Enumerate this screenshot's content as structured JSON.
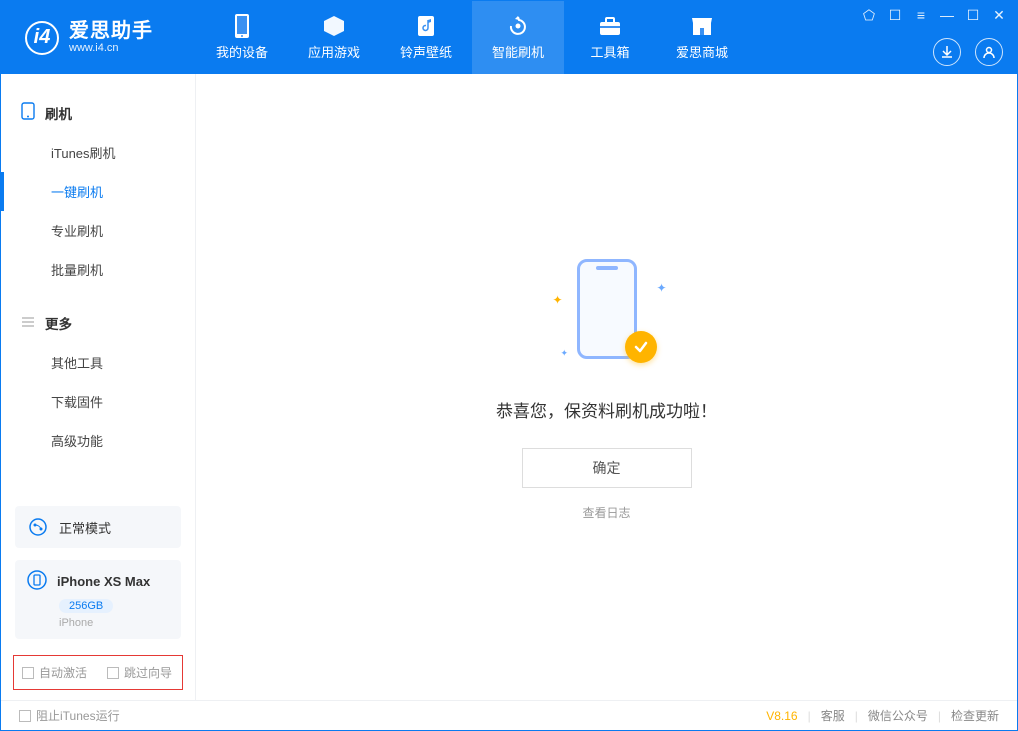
{
  "brand": {
    "logo_glyph": "i4",
    "title": "爱思助手",
    "subtitle": "www.i4.cn"
  },
  "tabs": [
    {
      "id": "device",
      "label": "我的设备",
      "icon": "phone-icon"
    },
    {
      "id": "apps",
      "label": "应用游戏",
      "icon": "cube-icon"
    },
    {
      "id": "ring",
      "label": "铃声壁纸",
      "icon": "music-icon"
    },
    {
      "id": "flash",
      "label": "智能刷机",
      "icon": "refresh-icon",
      "active": true
    },
    {
      "id": "tools",
      "label": "工具箱",
      "icon": "toolbox-icon"
    },
    {
      "id": "store",
      "label": "爱思商城",
      "icon": "store-icon"
    }
  ],
  "window_controls": {
    "shirt": "⬠",
    "theme": "☐",
    "menu": "≡",
    "min": "—",
    "max": "☐",
    "close": "✕"
  },
  "header_right": {
    "download_icon": "download-circle-icon",
    "user_icon": "user-circle-icon"
  },
  "sidebar": {
    "group1": {
      "title": "刷机",
      "icon": "phone-outline-icon",
      "items": [
        {
          "id": "itunes",
          "label": "iTunes刷机"
        },
        {
          "id": "onekey",
          "label": "一键刷机",
          "active": true
        },
        {
          "id": "pro",
          "label": "专业刷机"
        },
        {
          "id": "batch",
          "label": "批量刷机"
        }
      ]
    },
    "group2": {
      "title": "更多",
      "icon": "more-icon",
      "items": [
        {
          "id": "other",
          "label": "其他工具"
        },
        {
          "id": "firmware",
          "label": "下载固件"
        },
        {
          "id": "adv",
          "label": "高级功能"
        }
      ]
    },
    "mode_box": {
      "label": "正常模式",
      "icon": "mode-icon"
    },
    "device_box": {
      "name": "iPhone XS Max",
      "storage": "256GB",
      "type": "iPhone",
      "icon": "device-icon"
    },
    "checkboxes": {
      "auto_activate": "自动激活",
      "skip_guide": "跳过向导"
    }
  },
  "main": {
    "success_text": "恭喜您，保资料刷机成功啦！",
    "ok_label": "确定",
    "log_link": "查看日志"
  },
  "statusbar": {
    "block_itunes": "阻止iTunes运行",
    "version": "V8.16",
    "links": [
      "客服",
      "微信公众号",
      "检查更新"
    ]
  }
}
